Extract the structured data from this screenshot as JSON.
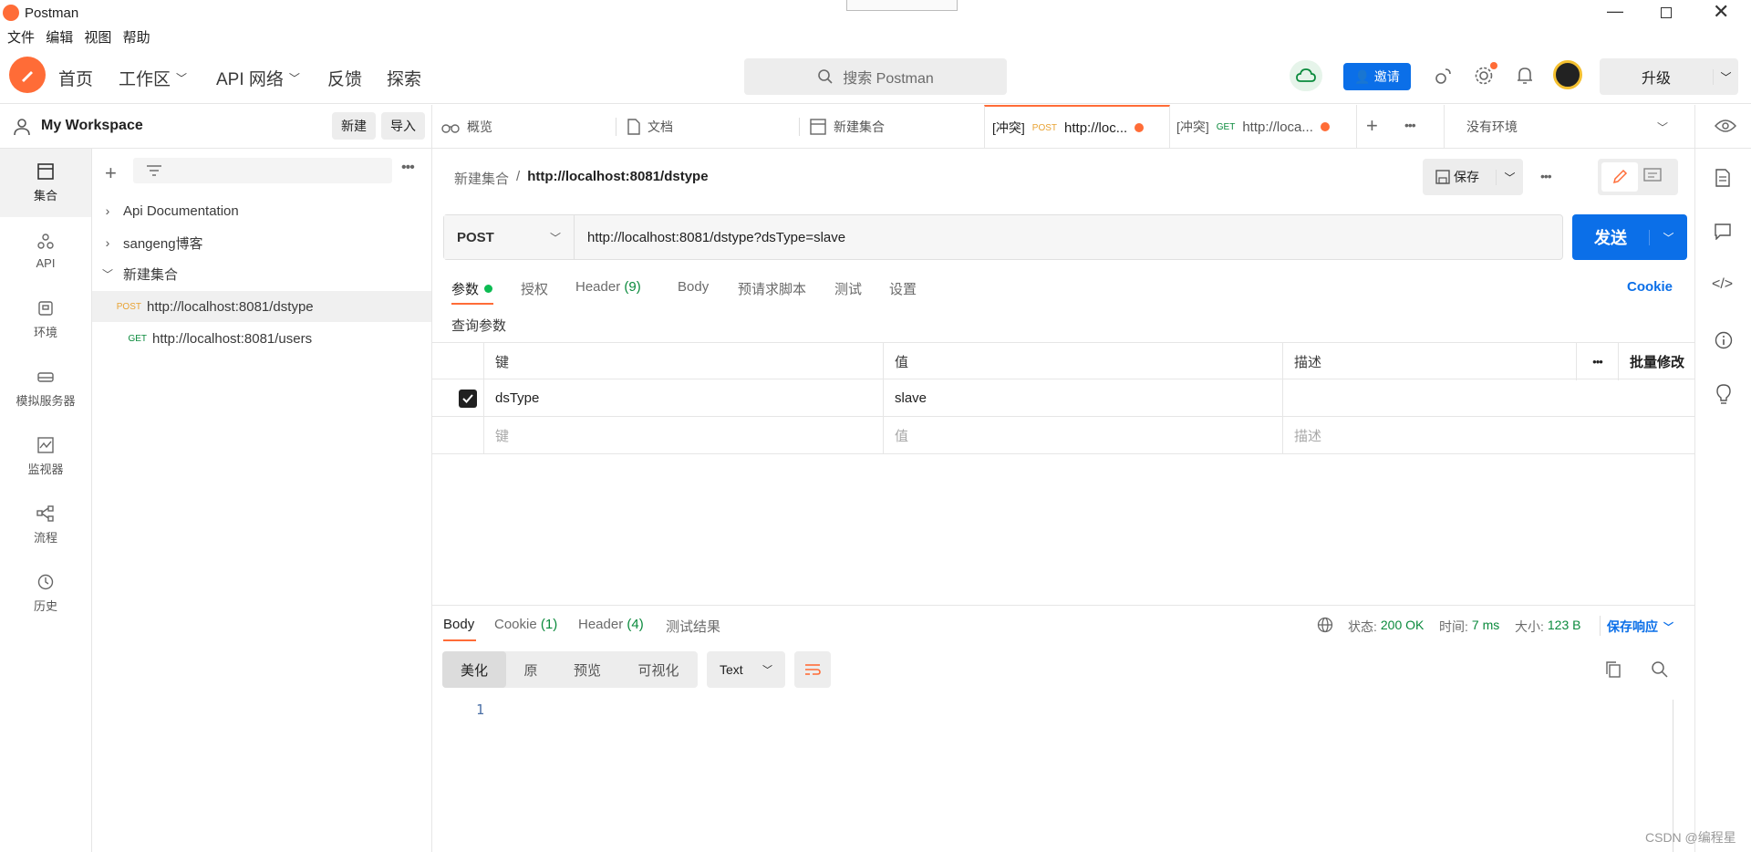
{
  "window": {
    "title": "Postman"
  },
  "menu": [
    "文件",
    "编辑",
    "视图",
    "帮助"
  ],
  "nav": {
    "home": "首页",
    "workspace": "工作区",
    "api_network": "API 网络",
    "feedback": "反馈",
    "explore": "探索"
  },
  "search": {
    "placeholder": "搜索 Postman"
  },
  "header_right": {
    "invite": "邀请",
    "upgrade": "升级"
  },
  "workspace": {
    "name": "My Workspace",
    "new": "新建",
    "import": "导入"
  },
  "rail": [
    {
      "label": "集合",
      "icon": "collections-icon"
    },
    {
      "label": "API",
      "icon": "api-icon"
    },
    {
      "label": "环境",
      "icon": "environment-icon"
    },
    {
      "label": "模拟服务器",
      "icon": "mock-server-icon"
    },
    {
      "label": "监视器",
      "icon": "monitor-icon"
    },
    {
      "label": "流程",
      "icon": "flows-icon"
    },
    {
      "label": "历史",
      "icon": "history-icon"
    }
  ],
  "tree": {
    "api_docs": "Api Documentation",
    "sangeng": "sangeng博客",
    "new_collection": "新建集合",
    "req1_method": "POST",
    "req1_url": "http://localhost:8081/dstype",
    "req2_method": "GET",
    "req2_url": "http://localhost:8081/users"
  },
  "tabs": {
    "overview": "概览",
    "docs": "文档",
    "new_collection": "新建集合",
    "conflict": "[冲突]",
    "tab4_method": "POST",
    "tab4_url": "http://loc...",
    "tab5_method": "GET",
    "tab5_url": "http://loca...",
    "env": "没有环境"
  },
  "request": {
    "breadcrumb_parent": "新建集合",
    "breadcrumb_sep": "/",
    "breadcrumb_title": "http://localhost:8081/dstype",
    "save": "保存",
    "method": "POST",
    "url": "http://localhost:8081/dstype?dsType=slave",
    "send": "发送",
    "tabs": {
      "params": "参数",
      "auth": "授权",
      "header": "Header",
      "header_count": "(9)",
      "body": "Body",
      "prescript": "预请求脚本",
      "tests": "测试",
      "settings": "设置",
      "cookie": "Cookie"
    },
    "query_title": "查询参数",
    "table": {
      "key": "键",
      "value": "值",
      "desc": "描述",
      "bulk": "批量修改",
      "row_key": "dsType",
      "row_value": "slave",
      "ph_key": "键",
      "ph_value": "值",
      "ph_desc": "描述"
    }
  },
  "response": {
    "tabs": {
      "body": "Body",
      "cookie": "Cookie",
      "cookie_count": "(1)",
      "header": "Header",
      "header_count": "(4)",
      "tests": "测试结果"
    },
    "status_label": "状态:",
    "status": "200 OK",
    "time_label": "时间:",
    "time": "7 ms",
    "size_label": "大小:",
    "size": "123 B",
    "save": "保存响应",
    "views": {
      "pretty": "美化",
      "raw": "原",
      "preview": "预览",
      "visualize": "可视化"
    },
    "format": "Text",
    "line1": "1"
  },
  "watermark": "CSDN @编程星",
  "colors": {
    "accent": "#ff6c37",
    "primary": "#0b6fe8",
    "success": "#0a8a3c"
  }
}
